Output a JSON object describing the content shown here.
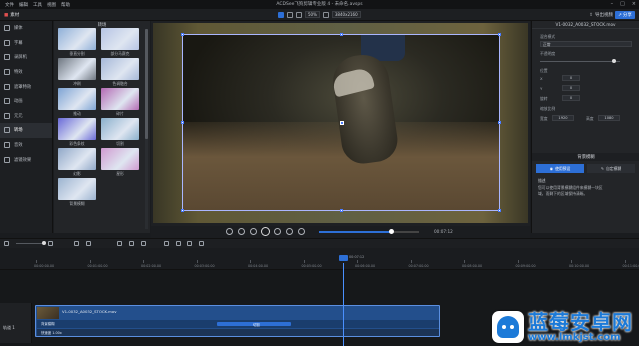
{
  "app": {
    "title": "ACDSee飞狗剪辑专业版 4 - 未命名.avsps",
    "menu": [
      "文件",
      "编辑",
      "工具",
      "视图",
      "帮助"
    ]
  },
  "toolbar": {
    "media_label": "素材",
    "zoom": "50%",
    "resolution": "3840x2160",
    "export_label": "导出视频",
    "share_label": "分享"
  },
  "sidebar": {
    "items": [
      {
        "label": "媒体",
        "icon": "media-icon"
      },
      {
        "label": "字幕",
        "icon": "subtitle-icon"
      },
      {
        "label": "录屏机",
        "icon": "recorder-icon"
      },
      {
        "label": "特效",
        "icon": "effects-icon"
      },
      {
        "label": "遮罩特效",
        "icon": "mask-icon"
      },
      {
        "label": "动画",
        "icon": "animation-icon"
      },
      {
        "label": "元元",
        "icon": "element-icon"
      },
      {
        "label": "转场",
        "icon": "transition-icon",
        "active": true
      },
      {
        "label": "音效",
        "icon": "audio-icon"
      },
      {
        "label": "滤镜效果",
        "icon": "filter-icon"
      }
    ]
  },
  "transitions": {
    "header": "转场",
    "items": [
      {
        "label": "垂直分割",
        "color": "#8fb0d8"
      },
      {
        "label": "部分马赛克",
        "color": "#b6c4e4"
      },
      {
        "label": "冲刷",
        "color": "#6e7680"
      },
      {
        "label": "色调融合",
        "color": "#a6b8d8"
      },
      {
        "label": "推动",
        "color": "#7ea4d4"
      },
      {
        "label": "碎片",
        "color": "#b46ab4"
      },
      {
        "label": "彩色条纹",
        "color": "#6a6ad8"
      },
      {
        "label": "切割",
        "color": "#8ab0cc"
      },
      {
        "label": "幻影",
        "color": "#90a8c8"
      },
      {
        "label": "星形",
        "color": "#d09ad0"
      },
      {
        "label": "背景模糊",
        "color": "#9cb4d0"
      }
    ]
  },
  "player": {
    "timecode": "00:07:12",
    "progress": 0.72
  },
  "properties": {
    "clip_name": "V1-0032_A0032_STOCK.mov",
    "blend_label": "混合模式",
    "blend_value": "正常",
    "opacity_label": "不透明度",
    "position_label": "位置",
    "x_label": "X",
    "y_label": "Y",
    "x_value": "0",
    "y_value": "0",
    "scale_label": "缩放比例",
    "width_label": "宽度",
    "height_label": "高度",
    "width_value": "1920",
    "height_value": "1080",
    "rotation_label": "旋转",
    "rotation_value": "0",
    "section_title": "背景模糊",
    "tab1": "使用预设",
    "tab2": "自定模糊",
    "desc_title": "描述",
    "description": "您可以使用背景模糊组件来模糊一块区域，而剩下的区域保持清晰。"
  },
  "ruler": {
    "playhead_time": "00:07:12",
    "ticks": [
      "00:00:00.00",
      "00:01:00.00",
      "00:02:00.00",
      "00:03:00.00",
      "00:04:00.00",
      "00:05:00.00",
      "00:06:00.00",
      "00:07:00.00",
      "00:08:00.00",
      "00:09:00.00",
      "00:10:00.00",
      "00:11:00.00"
    ]
  },
  "track": {
    "name": "轨道 1",
    "clip_name": "V1-0032_A0032_STOCK.mov",
    "lane1_label": "背景模糊",
    "lane2_label": "快速度 1.00x",
    "transition_label": "切割"
  },
  "watermark": {
    "title": "蓝莓安卓网",
    "url": "www.lmkjst.com"
  }
}
